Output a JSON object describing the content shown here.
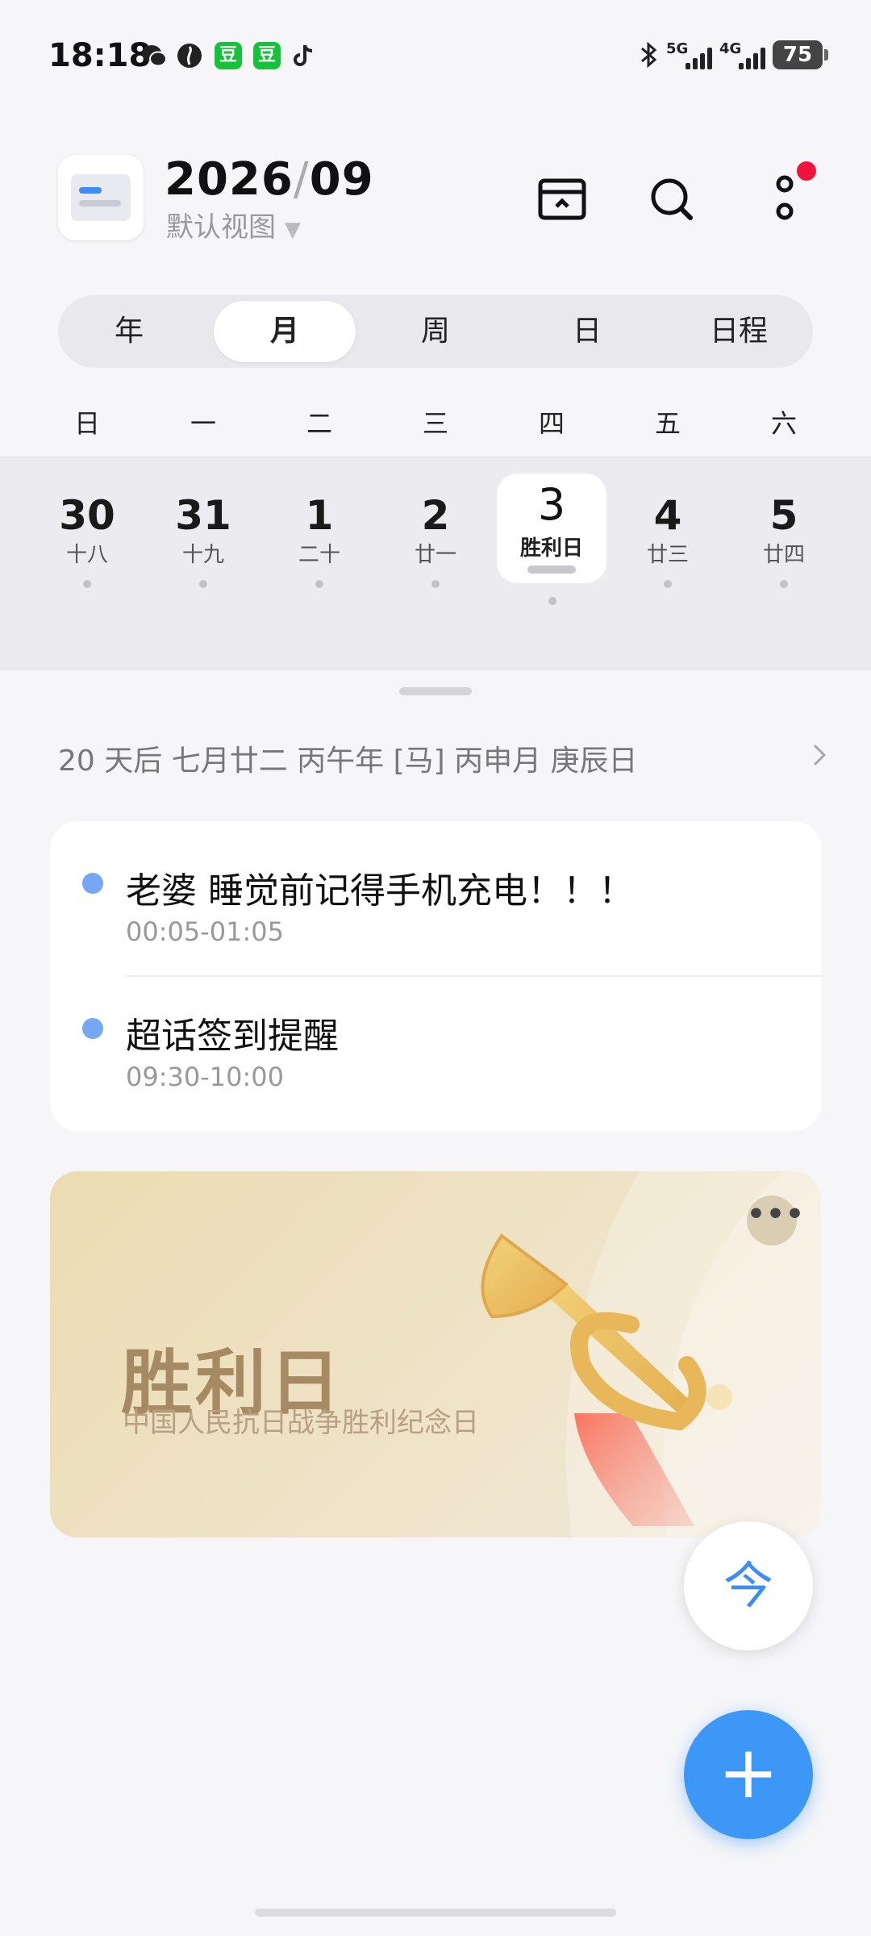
{
  "status_bar": {
    "time": "18:18",
    "app_icons": [
      "wechat-icon",
      "browser-icon",
      "douban-icon",
      "douban-icon",
      "tiktok-icon"
    ],
    "douban_glyph": "豆",
    "net1_label": "5G",
    "net2_label": "4G",
    "battery": "75",
    "colors": {
      "douban": "#16c23a"
    }
  },
  "header": {
    "year_month_year": "2026",
    "year_month_sep": "/",
    "year_month_month": "09",
    "view_label": "默认视图",
    "view_caret": "▼"
  },
  "tabs": [
    {
      "label": "年"
    },
    {
      "label": "月"
    },
    {
      "label": "周"
    },
    {
      "label": "日"
    },
    {
      "label": "日程"
    }
  ],
  "active_tab": "月",
  "weekdays": [
    "日",
    "一",
    "二",
    "三",
    "四",
    "五",
    "六"
  ],
  "week": [
    {
      "day": "30",
      "lunar": "十八"
    },
    {
      "day": "31",
      "lunar": "十九"
    },
    {
      "day": "1",
      "lunar": "二十"
    },
    {
      "day": "2",
      "lunar": "廿一"
    },
    {
      "day": "3",
      "lunar": "胜利日"
    },
    {
      "day": "4",
      "lunar": "廿三"
    },
    {
      "day": "5",
      "lunar": "廿四"
    }
  ],
  "lunar_info": "20 天后 七月廿二 丙午年 [马] 丙申月 庚辰日",
  "events": [
    {
      "title": "老婆 睡觉前记得手机充电！！！",
      "time": "00:05-01:05"
    },
    {
      "title": "超话签到提醒",
      "time": "09:30-10:00"
    }
  ],
  "holiday": {
    "title": "胜利日",
    "subtitle": "中国人民抗日战争胜利纪念日",
    "more": "•••"
  },
  "fab": {
    "today": "今",
    "add": "+"
  },
  "colors": {
    "accent": "#3c97f7",
    "event_dot": "#75a7f5",
    "notification": "#f0143c"
  }
}
